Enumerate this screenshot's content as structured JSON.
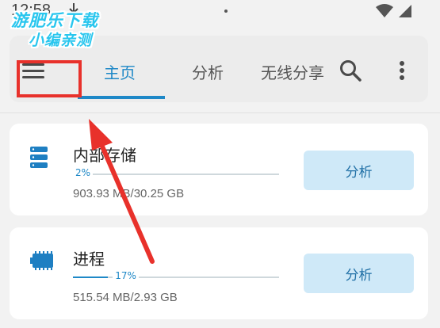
{
  "status_bar": {
    "time": "12:58",
    "icons": [
      "download-icon",
      "wifi-icon",
      "battery-icon"
    ]
  },
  "watermark": {
    "line1": "游肥乐下载",
    "line2": "小编亲测"
  },
  "toolbar": {
    "menu_icon": "hamburger-menu-icon",
    "tabs": [
      {
        "label": "主页",
        "active": true
      },
      {
        "label": "分析",
        "active": false
      },
      {
        "label": "无线分享",
        "active": false
      }
    ],
    "search_icon": "search-icon",
    "more_icon": "more-vertical-icon"
  },
  "cards": [
    {
      "icon": "storage-icon",
      "title": "内部存储",
      "progress": 2,
      "progress_label": "2%",
      "size": "903.93 MB/30.25 GB",
      "button": "分析"
    },
    {
      "icon": "chip-icon",
      "title": "进程",
      "progress": 17,
      "progress_label": "17%",
      "size": "515.54 MB/2.93 GB",
      "button": "分析"
    }
  ],
  "colors": {
    "accent": "#1e88c7",
    "highlight": "#e8312b",
    "button_bg": "#cfe9f8"
  }
}
